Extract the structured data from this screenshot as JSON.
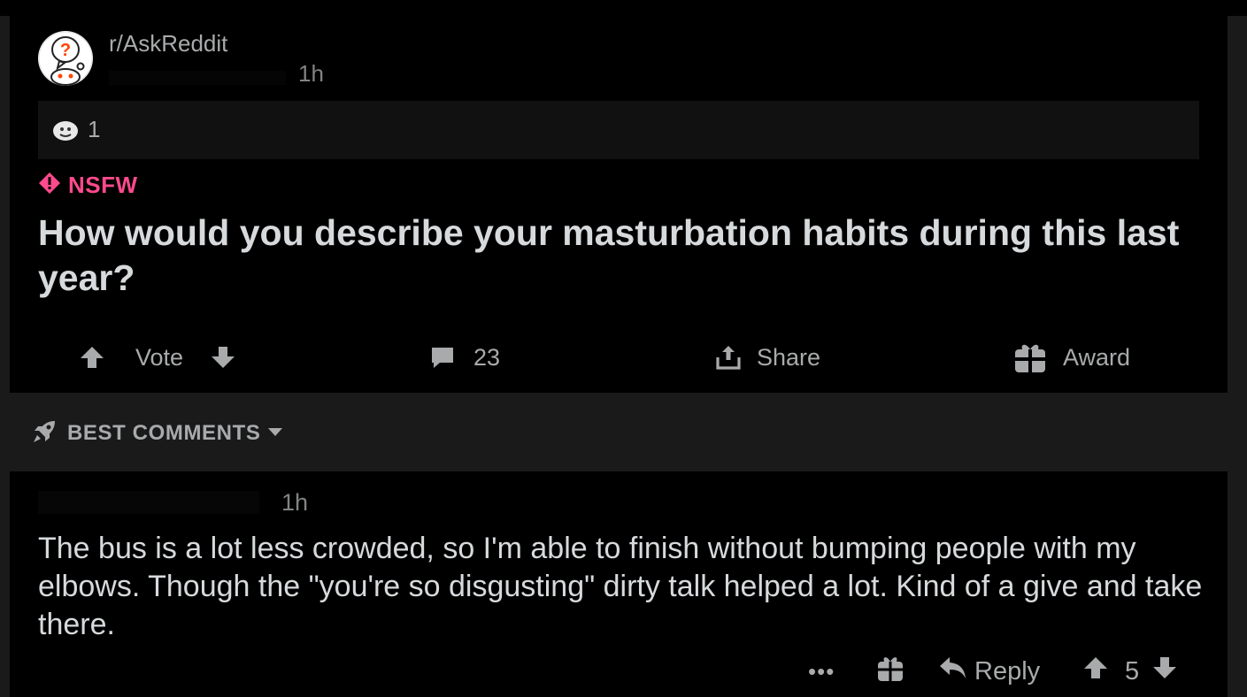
{
  "post": {
    "subreddit": "r/AskReddit",
    "time": "1h",
    "award_count": "1",
    "nsfw_label": "NSFW",
    "title": "How would you describe your masturbation habits during this last year?",
    "actions": {
      "vote_label": "Vote",
      "comment_count": "23",
      "share_label": "Share",
      "award_label": "Award"
    }
  },
  "sort": {
    "label": "BEST COMMENTS"
  },
  "comment": {
    "time": "1h",
    "body": "The bus is a lot less crowded, so I'm able to finish without bumping people with my elbows. Though the \"you're so disgusting\" dirty talk helped a lot. Kind of a give and take there.",
    "more_label": "•••",
    "reply_label": "Reply",
    "score": "5"
  },
  "colors": {
    "nsfw": "#ff4a8d",
    "background": "#000000",
    "page": "#1a1a1b"
  },
  "icons": [
    "subreddit-avatar",
    "award-icon",
    "nsfw-icon",
    "upvote-icon",
    "downvote-icon",
    "comment-icon",
    "share-icon",
    "gift-icon",
    "rocket-icon",
    "caret-down-icon",
    "reply-icon"
  ]
}
